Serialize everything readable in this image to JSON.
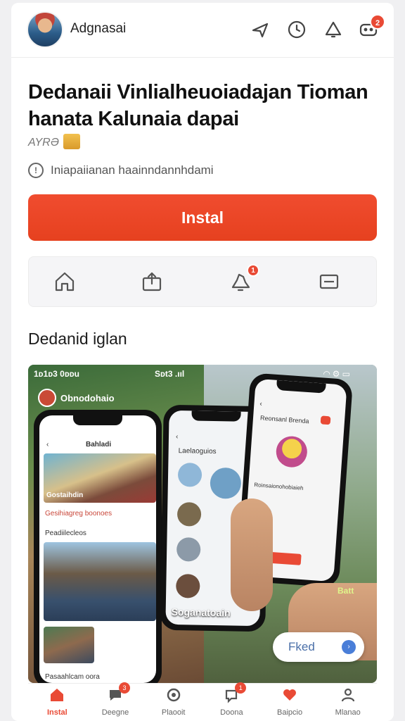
{
  "header": {
    "username": "Adgnasai",
    "notification_count": "2"
  },
  "app": {
    "title": "Dedanaii Vinlialheuoiadajan Tioman hanata Kalunaia dapai",
    "meta": "AYRƏ",
    "info_text": "Iniapaiianan haainndannhdami",
    "install_label": "Instal",
    "action_badge": "1"
  },
  "section": {
    "title": "Dedanid iglan"
  },
  "screenshots": {
    "status_left": "1ᴅ1ᴅ3 0ᴅᴅu",
    "status_mid": "Sᴅt3 .ııl",
    "left_account": "Obnodohaio",
    "left_header": "Bahladi",
    "left_caption1": "Gostaihdin",
    "left_caption2": "Gesihiagreg boonoes",
    "left_section": "Peadiilecleos",
    "left_footer": "Pasaahlcam oora",
    "mid_tab": "Laelaoguios",
    "mid_label": "Soganatoain",
    "right_header": "Reonsanl Brenda",
    "right_item": "Roinsaionohobiaieh",
    "right_badge": "Batt",
    "feed_label": "Fked"
  },
  "bottom_nav": {
    "items": [
      {
        "label": "Instal",
        "icon": "home-icon"
      },
      {
        "label": "Deegne",
        "icon": "chat-icon",
        "badge": "3"
      },
      {
        "label": "Plaooit",
        "icon": "compass-icon"
      },
      {
        "label": "Doona",
        "icon": "message-icon",
        "badge": "1"
      },
      {
        "label": "Baipcio",
        "icon": "heart-icon"
      },
      {
        "label": "Mlanao",
        "icon": "profile-icon"
      }
    ]
  },
  "colors": {
    "accent": "#e94a35",
    "install_button": "#f04c2f"
  }
}
